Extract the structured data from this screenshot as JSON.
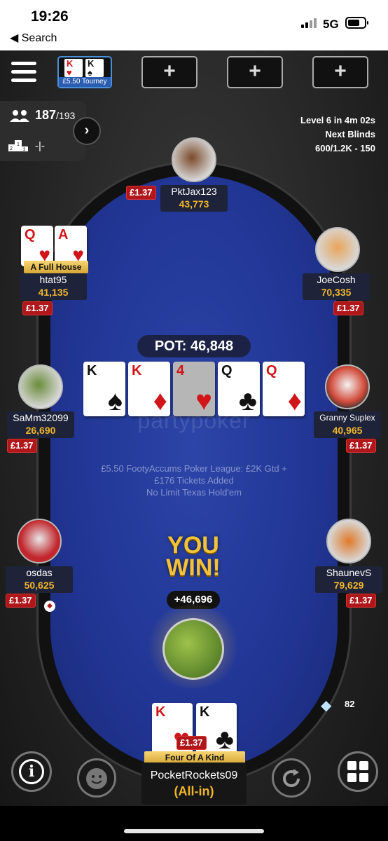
{
  "status_bar": {
    "time": "19:26",
    "back_label": "◀ Search",
    "network": "5G"
  },
  "tabs": {
    "tourney_label": "£5.50 Tourney",
    "tourney_cards": [
      {
        "rank": "K",
        "suit": "♥",
        "color": "red"
      },
      {
        "rank": "K",
        "suit": "♠",
        "color": "black"
      }
    ],
    "add_symbol": "+"
  },
  "tournament": {
    "players_remaining": "187",
    "players_total": "/193",
    "rank": "-|-"
  },
  "blinds": {
    "level": "Level 6 in 4m 02s",
    "next_label": "Next Blinds",
    "next_value": "600/1.2K - 150"
  },
  "table": {
    "logo": "partypoker",
    "description_lines": [
      "£5.50 FootyAccums Poker League: £2K Gtd +",
      "£176 Tickets Added",
      "No Limit Texas Hold'em"
    ],
    "pot": "POT: 46,848",
    "board": [
      {
        "rank": "K",
        "suit": "♠",
        "color": "black",
        "dim": false
      },
      {
        "rank": "K",
        "suit": "♦",
        "color": "red",
        "dim": false
      },
      {
        "rank": "4",
        "suit": "♥",
        "color": "red",
        "dim": true
      },
      {
        "rank": "Q",
        "suit": "♣",
        "color": "black",
        "dim": false
      },
      {
        "rank": "Q",
        "suit": "♦",
        "color": "red",
        "dim": false
      }
    ]
  },
  "players": {
    "top": {
      "name": "PktJax123",
      "stack": "43,773",
      "bet": "£1.37"
    },
    "left1": {
      "name": "htat95",
      "stack": "41,135",
      "bet": "£1.37",
      "hand": "A Full House",
      "cards": [
        {
          "rank": "Q",
          "suit": "♥",
          "color": "red"
        },
        {
          "rank": "A",
          "suit": "♥",
          "color": "red"
        }
      ]
    },
    "right1": {
      "name": "JoeCosh",
      "stack": "70,335",
      "bet": "£1.37"
    },
    "left2": {
      "name": "SaMm32099",
      "stack": "26,690",
      "bet": "£1.37"
    },
    "right2": {
      "name": "Granny Suplex",
      "stack": "40,965",
      "bet": "£1.37"
    },
    "left3": {
      "name": "osdas",
      "stack": "50,625",
      "bet": "£1.37"
    },
    "right3": {
      "name": "ShaunevS",
      "stack": "79,629",
      "bet": "£1.37"
    }
  },
  "hero": {
    "win_line1": "YOU",
    "win_line2": "WIN!",
    "win_amount": "+46,696",
    "name": "PocketRockets09",
    "status": "(All-in)",
    "bet": "£1.37",
    "hand": "Four Of A Kind",
    "cards": [
      {
        "rank": "K",
        "suit": "♥",
        "color": "red"
      },
      {
        "rank": "K",
        "suit": "♣",
        "color": "black"
      }
    ],
    "diamonds": "82"
  },
  "icons": [
    "menu-icon",
    "people-icon",
    "podium-icon",
    "chevron-right-icon",
    "info-icon",
    "smiley-icon",
    "refresh-icon",
    "grid-icon",
    "diamond-icon",
    "dealer-chip-icon"
  ],
  "colors": {
    "felt": "#213594",
    "bet_red": "#b0171b",
    "stack_gold": "#f0b62a",
    "win_gold": "#f2c23a",
    "tab_blue": "#4a90d9"
  }
}
